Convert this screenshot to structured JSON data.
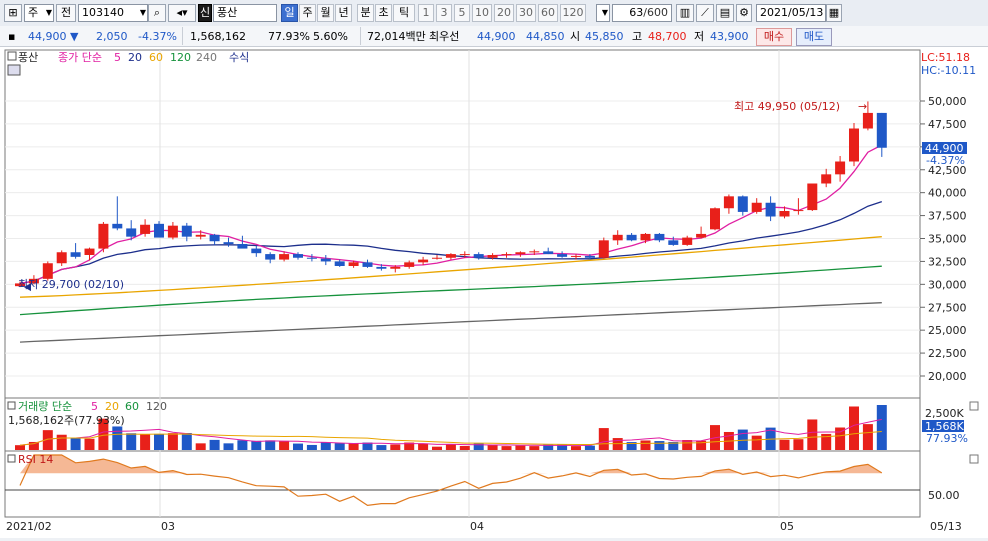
{
  "toolbar": {
    "type_select": "주",
    "mode_label": "전",
    "code_value": "103140",
    "name_badge": "신",
    "stock_name": "풍산",
    "periods": [
      "일",
      "주",
      "월",
      "년",
      "분",
      "초",
      "틱"
    ],
    "selected_period": "일",
    "minute_values": [
      "1",
      "3",
      "5",
      "10",
      "20",
      "30",
      "60",
      "120"
    ],
    "count_value": "63",
    "count_total": "/600",
    "date_value": "2021/05/13"
  },
  "quote": {
    "price": "44,900",
    "change": "2,050",
    "change_pct": "-4.37%",
    "volume": "1,568,162",
    "vol_ratio": "77.93%",
    "turnover_rate": "5.60%",
    "amount": "72,014백만",
    "priority_label": "최우선",
    "priority_ask": "44,900",
    "priority_bid": "44,850",
    "open_label": "시",
    "open": "45,850",
    "high_label": "고",
    "high": "48,700",
    "low_label": "저",
    "low": "43,900",
    "buy_button": "매수",
    "sell_button": "매도"
  },
  "colors": {
    "up": "#e8201a",
    "down": "#1f58c7",
    "ma5": "#e01fa2",
    "ma20": "#1d2f8c",
    "ma60": "#e9a500",
    "ma120": "#16923c",
    "ma240": "#666666",
    "rsi_line": "#e07a1f",
    "rsi_fill": "#f4b08a"
  },
  "price_panel": {
    "stock_tag": "풍산",
    "legend_price": "종가 단순",
    "ma_periods": [
      "5",
      "20",
      "60",
      "120",
      "240"
    ],
    "formula_label": "수식",
    "right_lc": "LC:51.18",
    "right_hc": "HC:-10.11",
    "max_annotation": "최고 49,950 (05/12)",
    "min_annotation": "최저 29,700 (02/10)",
    "last_price_tag": "44,900",
    "last_change_tag": "-4.37%",
    "y_ticks": [
      "50,000",
      "47,500",
      "45,000",
      "42,500",
      "40,000",
      "37,500",
      "35,000",
      "32,500",
      "30,000",
      "27,500",
      "25,000",
      "22,500",
      "20,000"
    ]
  },
  "volume_panel": {
    "title": "거래량 단순",
    "ma_periods": [
      "5",
      "20",
      "60",
      "120"
    ],
    "value_label": "1,568,162주(77.93%)",
    "y_tick": "2,500K",
    "last_tag": "1,568K",
    "last_ratio": "77.93%"
  },
  "rsi_panel": {
    "title": "RSI 14",
    "y_tick": "50.00"
  },
  "x_axis": {
    "labels": [
      "2021/02",
      "03",
      "04",
      "05"
    ],
    "right_date": "05/13"
  },
  "chart_data": {
    "type": "candlestick",
    "y_min": 20000,
    "y_max": 50000,
    "candles": [
      [
        29800,
        30300,
        29700,
        30100
      ],
      [
        30100,
        31000,
        30000,
        30600
      ],
      [
        30600,
        32500,
        30400,
        32300
      ],
      [
        32300,
        33700,
        32000,
        33500
      ],
      [
        33500,
        34500,
        32800,
        33000
      ],
      [
        33200,
        34000,
        32600,
        33900
      ],
      [
        33900,
        36800,
        33500,
        36600
      ],
      [
        36600,
        39600,
        35900,
        36100
      ],
      [
        36100,
        37000,
        34800,
        35200
      ],
      [
        35500,
        37100,
        35200,
        36500
      ],
      [
        36600,
        36900,
        35300,
        35100
      ],
      [
        35100,
        36800,
        34900,
        36400
      ],
      [
        36400,
        36700,
        34700,
        35200
      ],
      [
        35200,
        35900,
        34900,
        35400
      ],
      [
        35400,
        35500,
        34300,
        34700
      ],
      [
        34600,
        35100,
        34100,
        34400
      ],
      [
        34400,
        35300,
        34000,
        33900
      ],
      [
        33900,
        34200,
        33000,
        33400
      ],
      [
        33300,
        33500,
        32300,
        32700
      ],
      [
        32700,
        33600,
        32500,
        33300
      ],
      [
        33300,
        33500,
        32700,
        32900
      ],
      [
        32900,
        33300,
        32500,
        32800
      ],
      [
        32800,
        33200,
        32100,
        32500
      ],
      [
        32500,
        32700,
        31900,
        32000
      ],
      [
        32000,
        32600,
        31800,
        32400
      ],
      [
        32400,
        32700,
        31800,
        31900
      ],
      [
        31900,
        32200,
        31500,
        31700
      ],
      [
        31700,
        32100,
        31300,
        31900
      ],
      [
        31900,
        32600,
        31700,
        32400
      ],
      [
        32400,
        33000,
        32100,
        32700
      ],
      [
        32800,
        33200,
        32700,
        32900
      ],
      [
        32900,
        33400,
        32700,
        33300
      ],
      [
        33300,
        33600,
        32900,
        33300
      ],
      [
        33300,
        33500,
        32700,
        32900
      ],
      [
        32900,
        33400,
        32700,
        33200
      ],
      [
        33200,
        33500,
        32900,
        33300
      ],
      [
        33300,
        33600,
        33000,
        33500
      ],
      [
        33500,
        33800,
        33200,
        33600
      ],
      [
        33600,
        34000,
        33300,
        33300
      ],
      [
        33300,
        33600,
        32900,
        33000
      ],
      [
        33000,
        33300,
        32700,
        33100
      ],
      [
        33100,
        33300,
        32700,
        32900
      ],
      [
        32900,
        35100,
        32800,
        34800
      ],
      [
        34800,
        35900,
        34300,
        35400
      ],
      [
        35400,
        35600,
        34700,
        34800
      ],
      [
        34800,
        35600,
        34500,
        35500
      ],
      [
        35500,
        35600,
        34600,
        34800
      ],
      [
        34800,
        35200,
        34200,
        34300
      ],
      [
        34300,
        35300,
        34200,
        35100
      ],
      [
        35100,
        36300,
        35000,
        35500
      ],
      [
        36000,
        38400,
        35900,
        38300
      ],
      [
        38300,
        39800,
        37700,
        39600
      ],
      [
        39600,
        39700,
        37500,
        37900
      ],
      [
        37900,
        39400,
        37700,
        38900
      ],
      [
        38900,
        39600,
        36900,
        37400
      ],
      [
        37400,
        38500,
        37200,
        38000
      ],
      [
        38000,
        39400,
        37600,
        38100
      ],
      [
        38100,
        41000,
        38000,
        41000
      ],
      [
        41000,
        42600,
        40600,
        42000
      ],
      [
        42000,
        44000,
        41200,
        43400
      ],
      [
        43400,
        47600,
        42900,
        47000
      ],
      [
        47000,
        49950,
        46800,
        48700
      ],
      [
        48700,
        48700,
        43900,
        44900
      ]
    ]
  }
}
